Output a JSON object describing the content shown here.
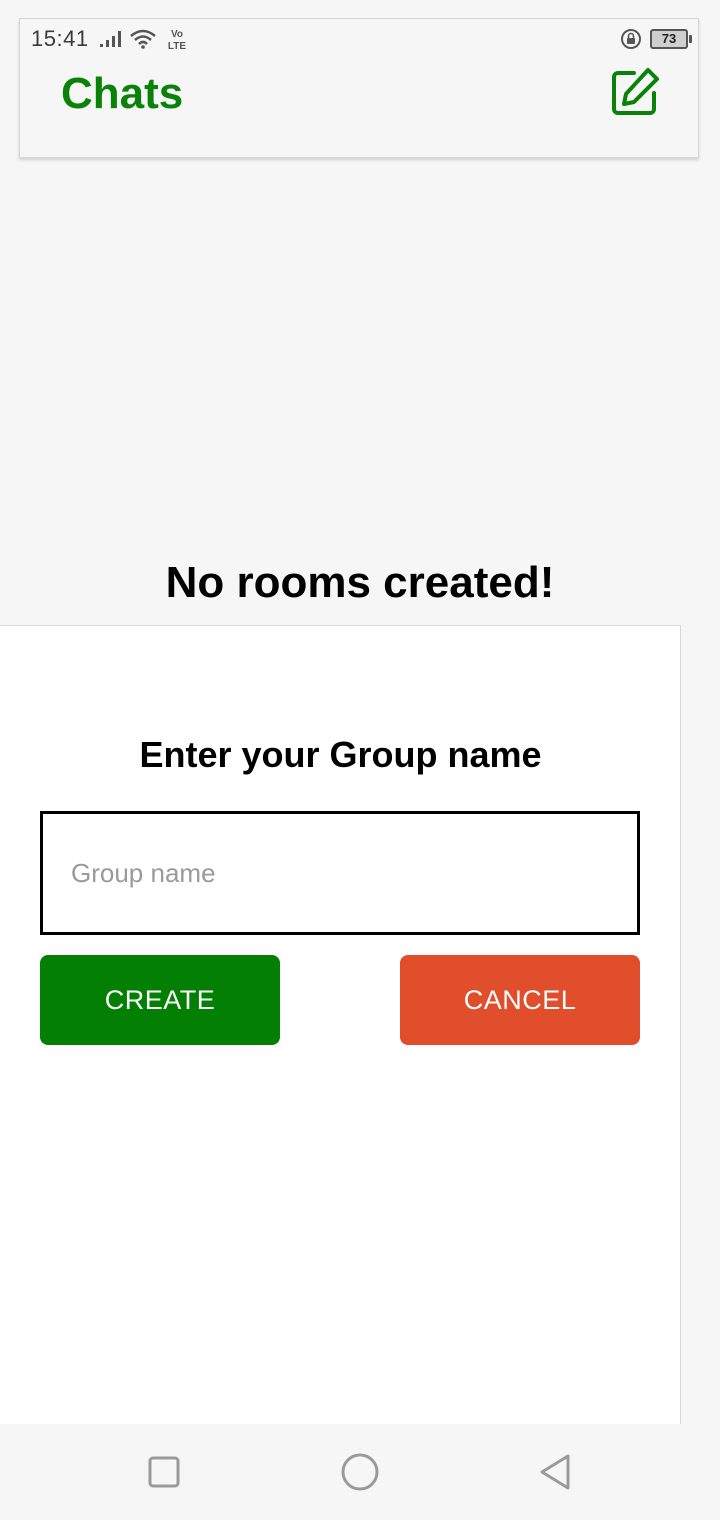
{
  "status_bar": {
    "time": "15:41",
    "network_label": "Vo LTE",
    "battery_level": "73",
    "icons": [
      "signal-icon",
      "wifi-icon",
      "volte-icon",
      "rotation-lock-icon",
      "battery-icon"
    ]
  },
  "header": {
    "title": "Chats",
    "compose_icon": "edit-icon"
  },
  "main": {
    "empty_message": "No rooms created!"
  },
  "dialog": {
    "title": "Enter your Group name",
    "input_value": "",
    "input_placeholder": "Group name",
    "create_label": "CREATE",
    "cancel_label": "CANCEL"
  },
  "nav_bar": {
    "icons": [
      "recent-apps-icon",
      "home-icon",
      "back-icon"
    ]
  },
  "colors": {
    "accent": "#0a8209",
    "create": "#038003",
    "cancel": "#e14e2c",
    "background": "#f6f6f6"
  }
}
